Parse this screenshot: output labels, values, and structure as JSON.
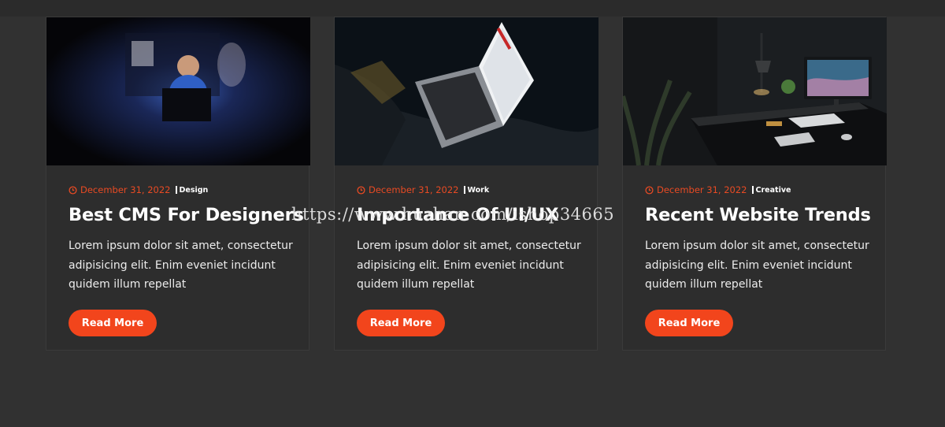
{
  "colors": {
    "page_background": "#313131",
    "card_background": "#2d2d2d",
    "accent": "#f2451c",
    "date_text": "#e84a23"
  },
  "cards": [
    {
      "image_alt": "child using laptop in dark",
      "date": "December 31, 2022",
      "date_icon": "clock-icon",
      "category": "Design",
      "title": "Best CMS For Designers",
      "excerpt": "Lorem ipsum dolor sit amet, consectetur adipisicing elit. Enim eveniet incidunt quidem illum repellat",
      "button_label": "Read More"
    },
    {
      "image_alt": "laptop on bed at night",
      "date": "December 31, 2022",
      "date_icon": "clock-icon",
      "category": "Work",
      "title": "Importance Of UI/UX",
      "excerpt": "Lorem ipsum dolor sit amet, consectetur adipisicing elit. Enim eveniet incidunt quidem illum repellat",
      "button_label": "Read More"
    },
    {
      "image_alt": "dark desk with monitor and lamp",
      "date": "December 31, 2022",
      "date_icon": "clock-icon",
      "category": "Creative",
      "title": "Recent Website Trends",
      "excerpt": "Lorem ipsum dolor sit amet, consectetur adipisicing elit. Enim eveniet incidunt quidem illum repellat",
      "button_label": "Read More"
    }
  ],
  "watermark": "https://www.huzhan.com/ishop34665"
}
